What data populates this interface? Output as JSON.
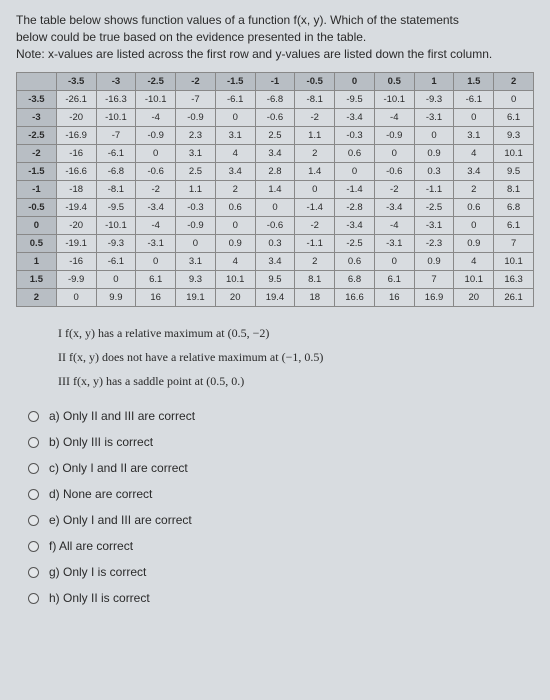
{
  "intro_line1": "The table below shows function values of a function f(x, y). Which of the statements",
  "intro_line2": "below could be true based on the evidence presented in the table.",
  "intro_line3": "Note: x-values are listed across the first row and y-values are listed down the first column.",
  "chart_data": {
    "type": "table",
    "title": "Function values f(x, y)",
    "x_values": [
      "-3.5",
      "-3",
      "-2.5",
      "-2",
      "-1.5",
      "-1",
      "-0.5",
      "0",
      "0.5",
      "1",
      "1.5",
      "2"
    ],
    "y_values": [
      "-3.5",
      "-3",
      "-2.5",
      "-2",
      "-1.5",
      "-1",
      "-0.5",
      "0",
      "0.5",
      "1",
      "1.5",
      "2"
    ],
    "rows": [
      [
        "-26.1",
        "-16.3",
        "-10.1",
        "-7",
        "-6.1",
        "-6.8",
        "-8.1",
        "-9.5",
        "-10.1",
        "-9.3",
        "-6.1",
        "0"
      ],
      [
        "-20",
        "-10.1",
        "-4",
        "-0.9",
        "0",
        "-0.6",
        "-2",
        "-3.4",
        "-4",
        "-3.1",
        "0",
        "6.1"
      ],
      [
        "-16.9",
        "-7",
        "-0.9",
        "2.3",
        "3.1",
        "2.5",
        "1.1",
        "-0.3",
        "-0.9",
        "0",
        "3.1",
        "9.3"
      ],
      [
        "-16",
        "-6.1",
        "0",
        "3.1",
        "4",
        "3.4",
        "2",
        "0.6",
        "0",
        "0.9",
        "4",
        "10.1"
      ],
      [
        "-16.6",
        "-6.8",
        "-0.6",
        "2.5",
        "3.4",
        "2.8",
        "1.4",
        "0",
        "-0.6",
        "0.3",
        "3.4",
        "9.5"
      ],
      [
        "-18",
        "-8.1",
        "-2",
        "1.1",
        "2",
        "1.4",
        "0",
        "-1.4",
        "-2",
        "-1.1",
        "2",
        "8.1"
      ],
      [
        "-19.4",
        "-9.5",
        "-3.4",
        "-0.3",
        "0.6",
        "0",
        "-1.4",
        "-2.8",
        "-3.4",
        "-2.5",
        "0.6",
        "6.8"
      ],
      [
        "-20",
        "-10.1",
        "-4",
        "-0.9",
        "0",
        "-0.6",
        "-2",
        "-3.4",
        "-4",
        "-3.1",
        "0",
        "6.1"
      ],
      [
        "-19.1",
        "-9.3",
        "-3.1",
        "0",
        "0.9",
        "0.3",
        "-1.1",
        "-2.5",
        "-3.1",
        "-2.3",
        "0.9",
        "7"
      ],
      [
        "-16",
        "-6.1",
        "0",
        "3.1",
        "4",
        "3.4",
        "2",
        "0.6",
        "0",
        "0.9",
        "4",
        "10.1"
      ],
      [
        "-9.9",
        "0",
        "6.1",
        "9.3",
        "10.1",
        "9.5",
        "8.1",
        "6.8",
        "6.1",
        "7",
        "10.1",
        "16.3"
      ],
      [
        "0",
        "9.9",
        "16",
        "19.1",
        "20",
        "19.4",
        "18",
        "16.6",
        "16",
        "16.9",
        "20",
        "26.1"
      ]
    ]
  },
  "stmt1": "I f(x, y) has a relative maximum at (0.5, −2)",
  "stmt2": "II f(x, y) does not have a relative maximum at (−1, 0.5)",
  "stmt3": "III f(x, y) has a saddle point at (0.5, 0.)",
  "options": {
    "a": "a)  Only II and III are correct",
    "b": "b)  Only III is correct",
    "c": "c)  Only I and II are correct",
    "d": "d)  None are correct",
    "e": "e)  Only I and III are correct",
    "f": "f)  All are correct",
    "g": "g)  Only I is correct",
    "h": "h)  Only II is correct"
  }
}
